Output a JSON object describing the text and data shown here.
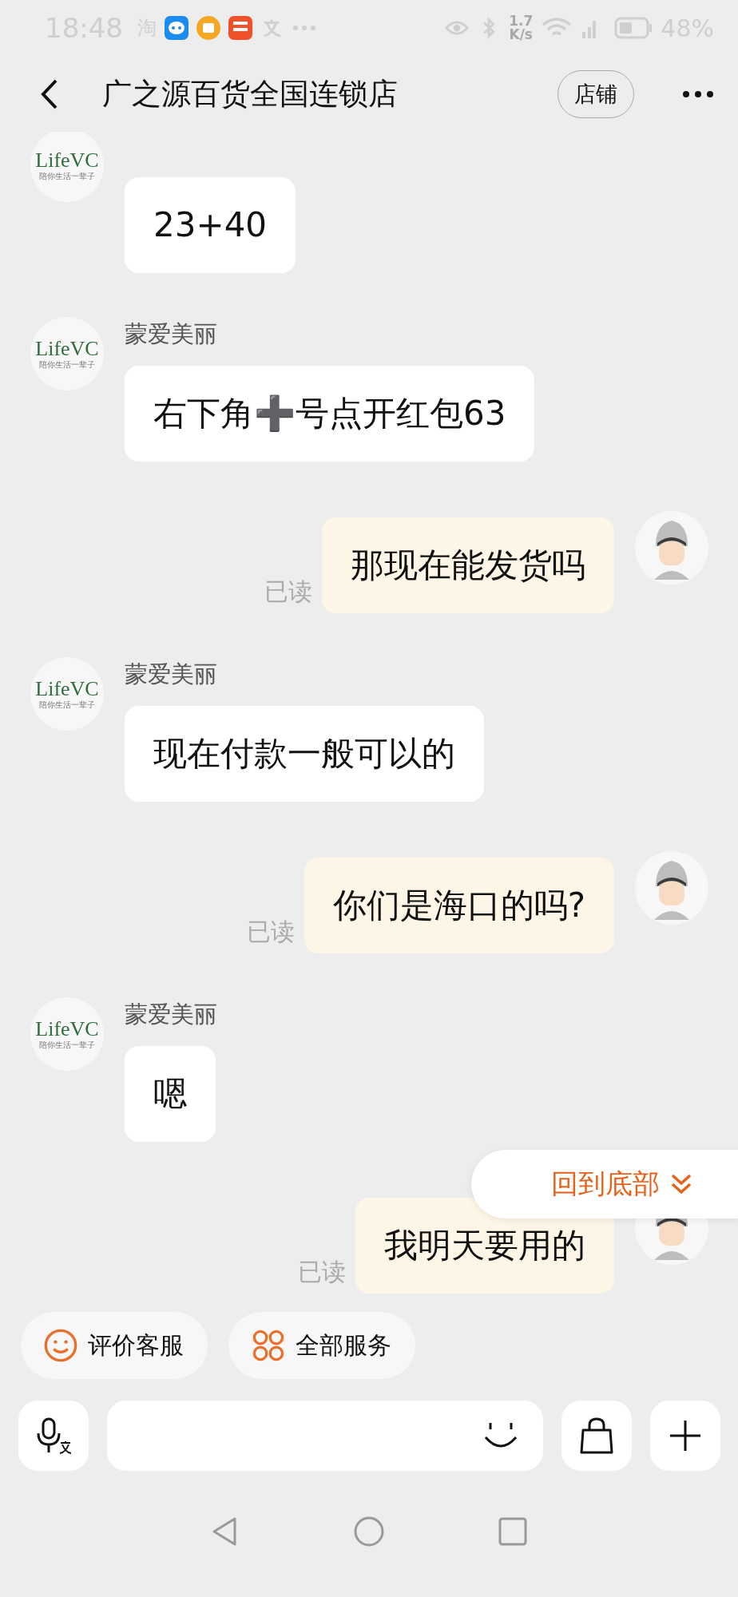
{
  "status_bar": {
    "time": "18:48",
    "app_mark": "淘",
    "speed": "1.7",
    "speed_unit": "K/s",
    "battery": "48%"
  },
  "header": {
    "title": "广之源百货全国连锁店",
    "shop_button": "店铺"
  },
  "messages": [
    {
      "kind": "incoming",
      "logo": "LifeVC",
      "tagline": "陪你生活一辈子",
      "text": "23+40"
    },
    {
      "kind": "incoming",
      "name": "蒙爱美丽",
      "logo": "LifeVC",
      "tagline": "陪你生活一辈子",
      "text": "右下角➕号点开红包63"
    },
    {
      "kind": "outgoing",
      "status": "已读",
      "text": "那现在能发货吗"
    },
    {
      "kind": "incoming",
      "name": "蒙爱美丽",
      "logo": "LifeVC",
      "tagline": "陪你生活一辈子",
      "text": "现在付款一般可以的"
    },
    {
      "kind": "outgoing",
      "status": "已读",
      "text": "你们是海口的吗?"
    },
    {
      "kind": "incoming",
      "name": "蒙爱美丽",
      "logo": "LifeVC",
      "tagline": "陪你生活一辈子",
      "text": "嗯"
    },
    {
      "kind": "outgoing",
      "status": "已读",
      "text": "我明天要用的"
    }
  ],
  "jump_button": "回到底部",
  "quick_actions": [
    {
      "kind": "rate",
      "label": "评价客服"
    },
    {
      "kind": "services",
      "label": "全部服务"
    }
  ]
}
